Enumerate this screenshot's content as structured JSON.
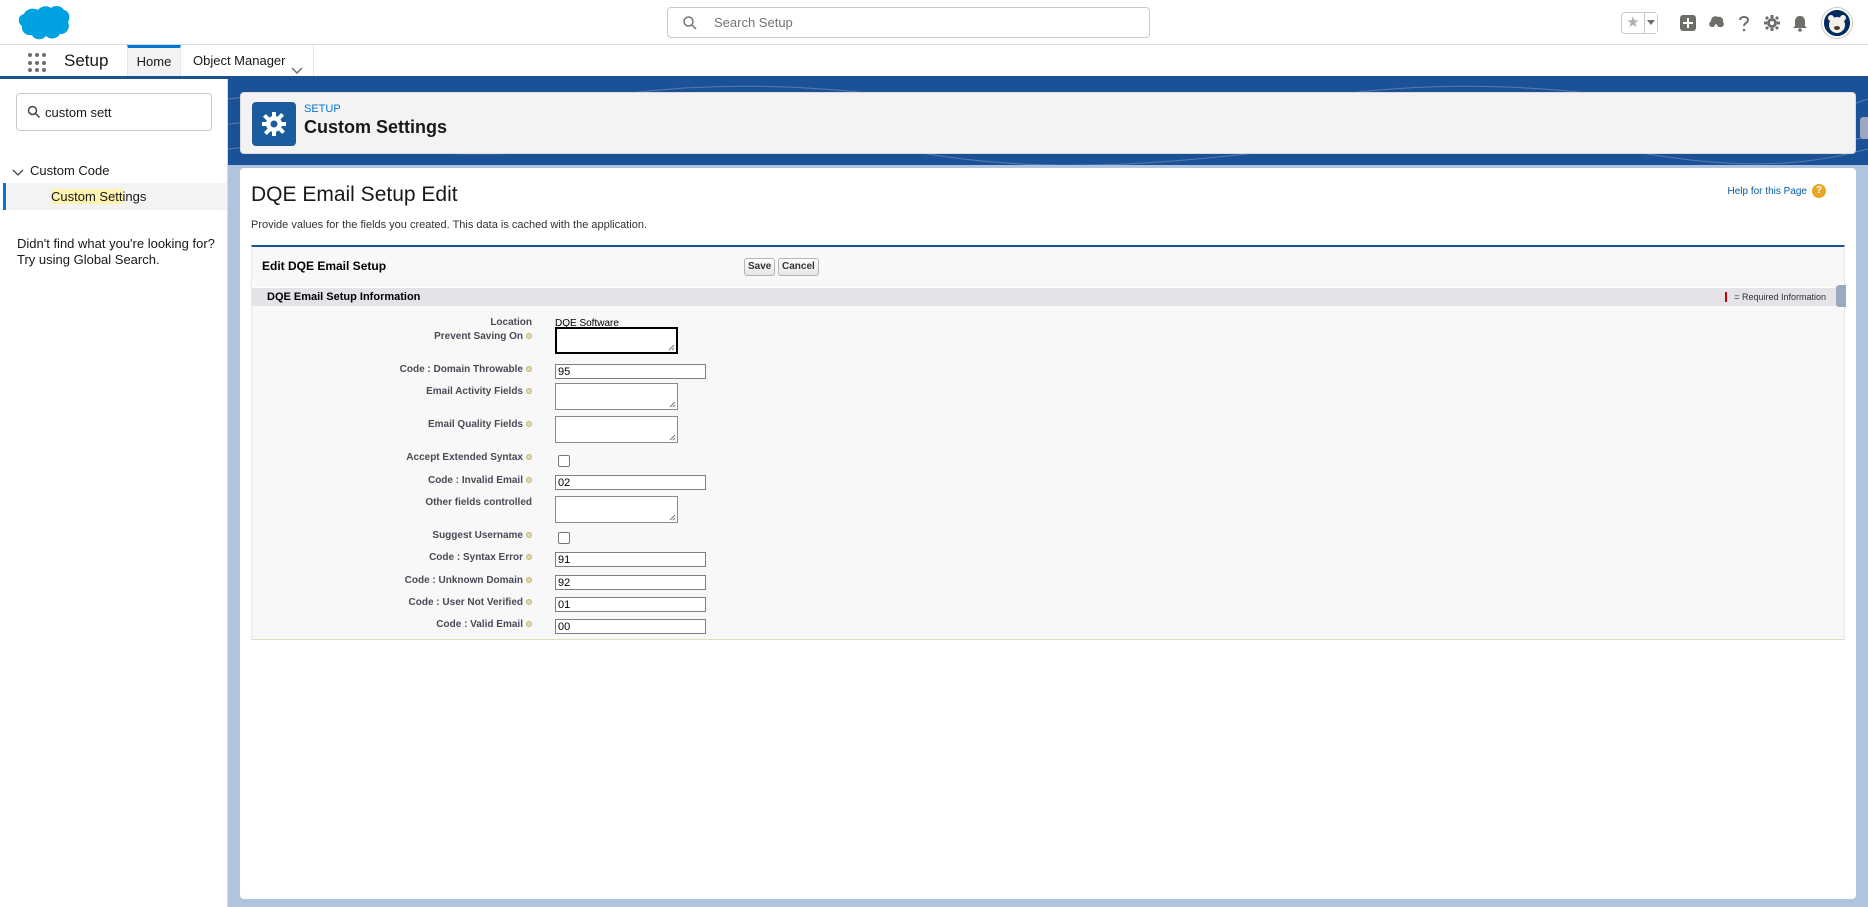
{
  "header": {
    "search_placeholder": "Search Setup"
  },
  "context_bar": {
    "app_name": "Setup",
    "tabs": [
      {
        "label": "Home"
      },
      {
        "label": "Object Manager"
      }
    ]
  },
  "left_nav": {
    "quick_find_value": "custom sett",
    "group_label": "Custom Code",
    "item_highlight": "Custom Sett",
    "item_rest": "ings",
    "help_line1": "Didn't find what you're looking for?",
    "help_line2": "Try using Global Search."
  },
  "page_header": {
    "breadcrumb": "SETUP",
    "title": "Custom Settings"
  },
  "content": {
    "title": "DQE Email Setup Edit",
    "help_link": "Help for this Page",
    "description": "Provide values for the fields you created. This data is cached with the application.",
    "edit_title": "Edit DQE Email Setup",
    "save_label": "Save",
    "cancel_label": "Cancel",
    "section_title": "DQE Email Setup Information",
    "required_info": "= Required Information"
  },
  "fields": {
    "location": {
      "label": "Location",
      "value": "DQE Software"
    },
    "prevent_saving_on": {
      "label": "Prevent Saving On",
      "value": ""
    },
    "code_domain_throwable": {
      "label": "Code : Domain Throwable",
      "value": "95"
    },
    "email_activity_fields": {
      "label": "Email Activity Fields",
      "value": ""
    },
    "email_quality_fields": {
      "label": "Email Quality Fields",
      "value": ""
    },
    "accept_extended_syntax": {
      "label": "Accept Extended Syntax",
      "checked": false
    },
    "code_invalid_email": {
      "label": "Code : Invalid Email",
      "value": "02"
    },
    "other_fields_controlled": {
      "label": "Other fields controlled",
      "value": ""
    },
    "suggest_username": {
      "label": "Suggest Username",
      "checked": false
    },
    "code_syntax_error": {
      "label": "Code : Syntax Error",
      "value": "91"
    },
    "code_unknown_domain": {
      "label": "Code : Unknown Domain",
      "value": "92"
    },
    "code_user_not_verified": {
      "label": "Code : User Not Verified",
      "value": "01"
    },
    "code_valid_email": {
      "label": "Code : Valid Email",
      "value": "00"
    }
  },
  "colors": {
    "brand_blue": "#0176d3",
    "header_band": "#1b5297",
    "setup_icon_bg": "#1a5c9e",
    "salesforce_cloud": "#00a1e0",
    "required_red": "#c00"
  }
}
